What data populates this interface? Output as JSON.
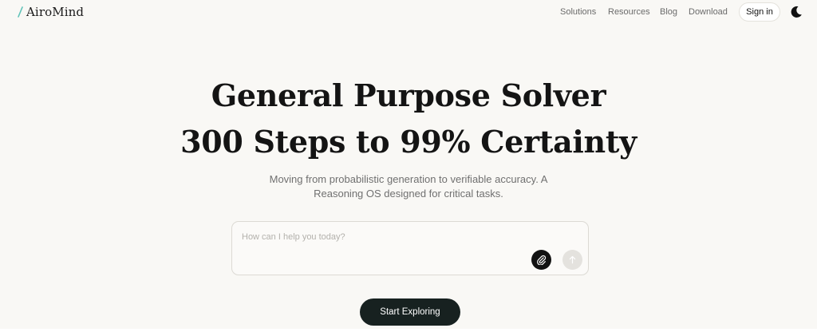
{
  "header": {
    "logo_text": "AiroMind",
    "nav": [
      {
        "label": "Solutions"
      },
      {
        "label": "Resources"
      },
      {
        "label": "Blog"
      },
      {
        "label": "Download"
      }
    ],
    "signin_label": "Sign in"
  },
  "hero": {
    "title_line1": "General Purpose Solver",
    "title_line2": "300 Steps to 99% Certainty",
    "subtitle": "Moving from probabilistic generation to verifiable accuracy. A Reasoning OS designed for critical tasks."
  },
  "prompt": {
    "placeholder": "How can I help you today?"
  },
  "cta_label": "Start Exploring",
  "colors": {
    "background": "#f9f8f5",
    "logo_accent": "#5fc3b8",
    "cta_bg": "#172120",
    "text": "#141414"
  },
  "icons": [
    "logo-mark-icon",
    "moon-icon",
    "paperclip-icon",
    "arrow-up-icon"
  ]
}
